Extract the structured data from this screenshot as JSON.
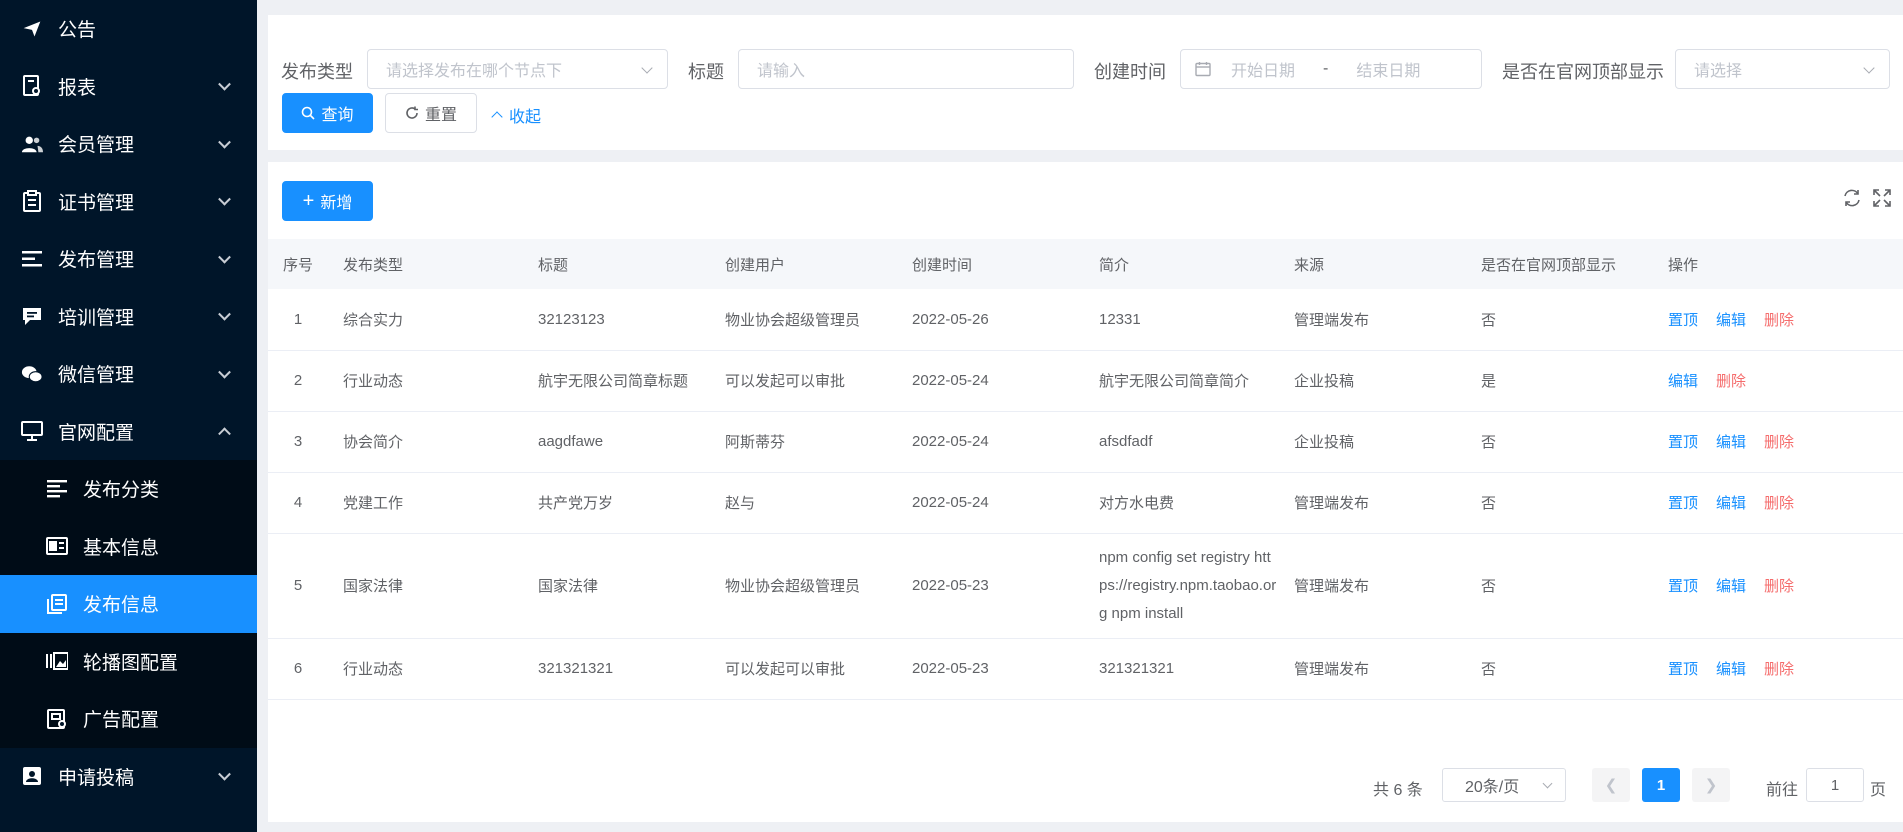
{
  "sidebar": {
    "items": [
      {
        "label": "公告",
        "icon": "send-icon",
        "has_children": false
      },
      {
        "label": "报表",
        "icon": "report-icon",
        "has_children": true
      },
      {
        "label": "会员管理",
        "icon": "users-icon",
        "has_children": true
      },
      {
        "label": "证书管理",
        "icon": "clipboard-icon",
        "has_children": true
      },
      {
        "label": "发布管理",
        "icon": "list-icon",
        "has_children": true
      },
      {
        "label": "培训管理",
        "icon": "chat-icon",
        "has_children": true
      },
      {
        "label": "微信管理",
        "icon": "wechat-icon",
        "has_children": true
      },
      {
        "label": "官网配置",
        "icon": "monitor-icon",
        "has_children": true,
        "expanded": true
      }
    ],
    "submenu": [
      {
        "label": "发布分类",
        "icon": "align-left-icon"
      },
      {
        "label": "基本信息",
        "icon": "id-card-icon"
      },
      {
        "label": "发布信息",
        "icon": "documents-icon",
        "active": true
      },
      {
        "label": "轮播图配置",
        "icon": "gallery-icon"
      },
      {
        "label": "广告配置",
        "icon": "ad-icon"
      }
    ],
    "after": [
      {
        "label": "申请投稿",
        "icon": "contact-icon",
        "has_children": true
      }
    ]
  },
  "filter": {
    "type_label": "发布类型",
    "type_placeholder": "请选择发布在哪个节点下",
    "title_label": "标题",
    "title_placeholder": "请输入",
    "created_label": "创建时间",
    "start_placeholder": "开始日期",
    "range_sep": "-",
    "end_placeholder": "结束日期",
    "top_label": "是否在官网顶部显示",
    "top_placeholder": "请选择",
    "query_button": "查询",
    "reset_button": "重置",
    "collapse_link": "收起"
  },
  "toolbar": {
    "add_button": "新增"
  },
  "table": {
    "columns": [
      "序号",
      "发布类型",
      "标题",
      "创建用户",
      "创建时间",
      "简介",
      "来源",
      "是否在官网顶部显示",
      "操作"
    ],
    "rows": [
      {
        "idx": "1",
        "type": "综合实力",
        "title": "32123123",
        "user": "物业协会超级管理员",
        "date": "2022-05-26",
        "desc": "12331",
        "source": "管理端发布",
        "top": "否",
        "ops": [
          "置顶",
          "编辑",
          "删除"
        ]
      },
      {
        "idx": "2",
        "type": "行业动态",
        "title": "航宇无限公司简章标题",
        "user": "可以发起可以审批",
        "date": "2022-05-24",
        "desc": "航宇无限公司简章简介",
        "source": "企业投稿",
        "top": "是",
        "ops": [
          "编辑",
          "删除"
        ]
      },
      {
        "idx": "3",
        "type": "协会简介",
        "title": "aagdfawe",
        "user": "阿斯蒂芬",
        "date": "2022-05-24",
        "desc": "afsdfadf",
        "source": "企业投稿",
        "top": "否",
        "ops": [
          "置顶",
          "编辑",
          "删除"
        ]
      },
      {
        "idx": "4",
        "type": "党建工作",
        "title": "共产党万岁",
        "user": "赵与",
        "date": "2022-05-24",
        "desc": "对方水电费",
        "source": "管理端发布",
        "top": "否",
        "ops": [
          "置顶",
          "编辑",
          "删除"
        ]
      },
      {
        "idx": "5",
        "type": "国家法律",
        "title": "国家法律",
        "user": "物业协会超级管理员",
        "date": "2022-05-23",
        "desc": "npm config set registry https://registry.npm.taobao.org npm install",
        "source": "管理端发布",
        "top": "否",
        "ops": [
          "置顶",
          "编辑",
          "删除"
        ]
      },
      {
        "idx": "6",
        "type": "行业动态",
        "title": "321321321",
        "user": "可以发起可以审批",
        "date": "2022-05-23",
        "desc": "321321321",
        "source": "管理端发布",
        "top": "否",
        "ops": [
          "置顶",
          "编辑",
          "删除"
        ]
      }
    ]
  },
  "pagination": {
    "total": "共 6 条",
    "page_size": "20条/页",
    "current_page": "1",
    "goto_label": "前往",
    "goto_value": "1",
    "page_unit": "页"
  },
  "colors": {
    "sidebar_bg": "#001529",
    "submenu_bg": "#000c17",
    "primary": "#1890ff",
    "danger": "#f56c6c"
  }
}
